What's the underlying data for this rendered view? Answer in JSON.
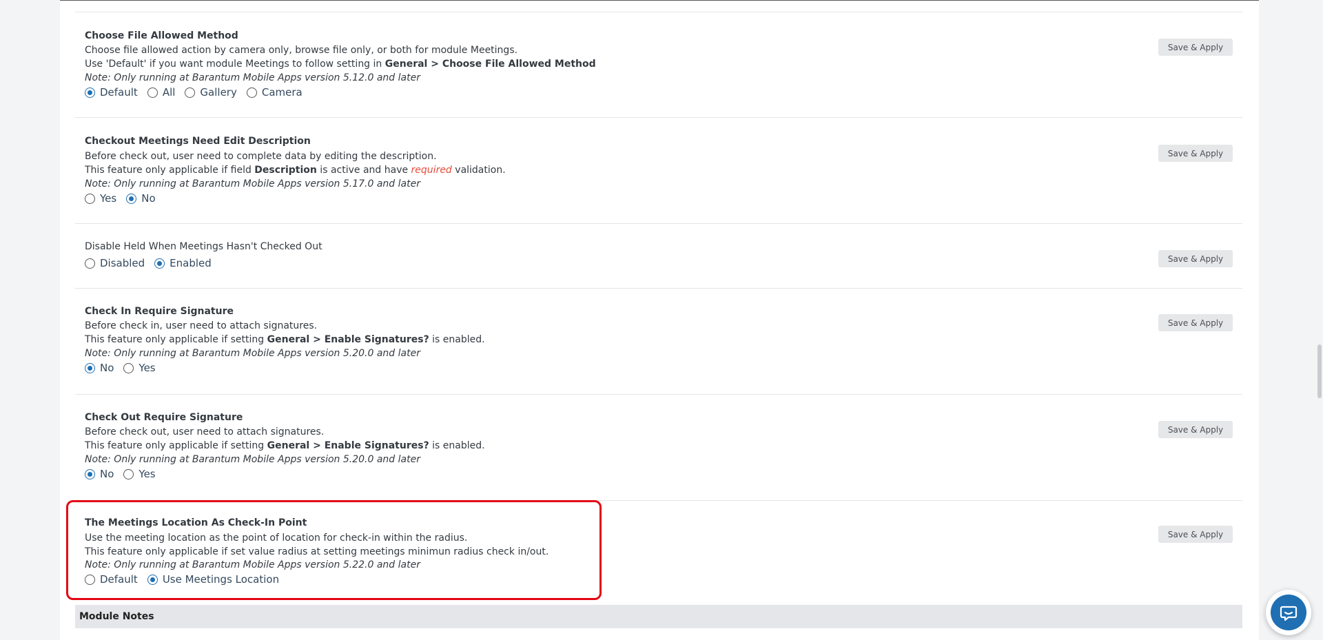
{
  "settings": [
    {
      "title": "Choose File Allowed Method",
      "line1": "Choose file allowed action by camera only, browse file only, or both for module Meetings.",
      "line2_pre": "Use 'Default' if you want module Meetings to follow setting in ",
      "line2_bold": "General > Choose File Allowed Method",
      "note_label": "Note",
      "note_text": ": Only running at Barantum Mobile Apps version 5.12.0 and later",
      "options": [
        "Default",
        "All",
        "Gallery",
        "Camera"
      ],
      "selected": "Default",
      "button": "Save & Apply"
    },
    {
      "title": "Checkout Meetings Need Edit Description",
      "line1": "Before check out, user need to complete data by editing the description.",
      "line2_pre": "This feature only applicable if field ",
      "line2_bold": "Description",
      "line2_mid": " is active and have ",
      "line2_req": "required",
      "line2_post": " validation.",
      "note_label": "Note",
      "note_text": ": Only running at Barantum Mobile Apps version 5.17.0 and later",
      "options": [
        "Yes",
        "No"
      ],
      "selected": "No",
      "button": "Save & Apply"
    },
    {
      "title": "Disable Held When Meetings Hasn't Checked Out",
      "options": [
        "Disabled",
        "Enabled"
      ],
      "selected": "Enabled",
      "button": "Save & Apply"
    },
    {
      "title": "Check In Require Signature",
      "line1": "Before check in, user need to attach signatures.",
      "line2_pre": "This feature only applicable if setting ",
      "line2_bold": "General > Enable Signatures?",
      "line2_post": " is enabled.",
      "note_label": "Note",
      "note_text": ": Only running at Barantum Mobile Apps version 5.20.0 and later",
      "options": [
        "No",
        "Yes"
      ],
      "selected": "No",
      "button": "Save & Apply"
    },
    {
      "title": "Check Out Require Signature",
      "line1": "Before check out, user need to attach signatures.",
      "line2_pre": "This feature only applicable if setting ",
      "line2_bold": "General > Enable Signatures?",
      "line2_post": " is enabled.",
      "note_label": "Note",
      "note_text": ": Only running at Barantum Mobile Apps version 5.20.0 and later",
      "options": [
        "No",
        "Yes"
      ],
      "selected": "No",
      "button": "Save & Apply"
    },
    {
      "title": "The Meetings Location As Check-In Point",
      "line1": "Use the meeting location as the point of location for check-in within the radius.",
      "line2_pre": "This feature only applicable if set value radius at setting meetings minimun radius check in/out.",
      "note_label": "Note",
      "note_text": ": Only running at Barantum Mobile Apps version 5.22.0 and later",
      "options": [
        "Default",
        "Use Meetings Location"
      ],
      "selected": "Use Meetings Location",
      "button": "Save & Apply"
    }
  ],
  "section_header": "Module Notes",
  "chat_icon": "chat-support-icon",
  "colors": {
    "accent": "#1f6fb2",
    "highlight": "#e30613",
    "required": "#e74c3c"
  }
}
